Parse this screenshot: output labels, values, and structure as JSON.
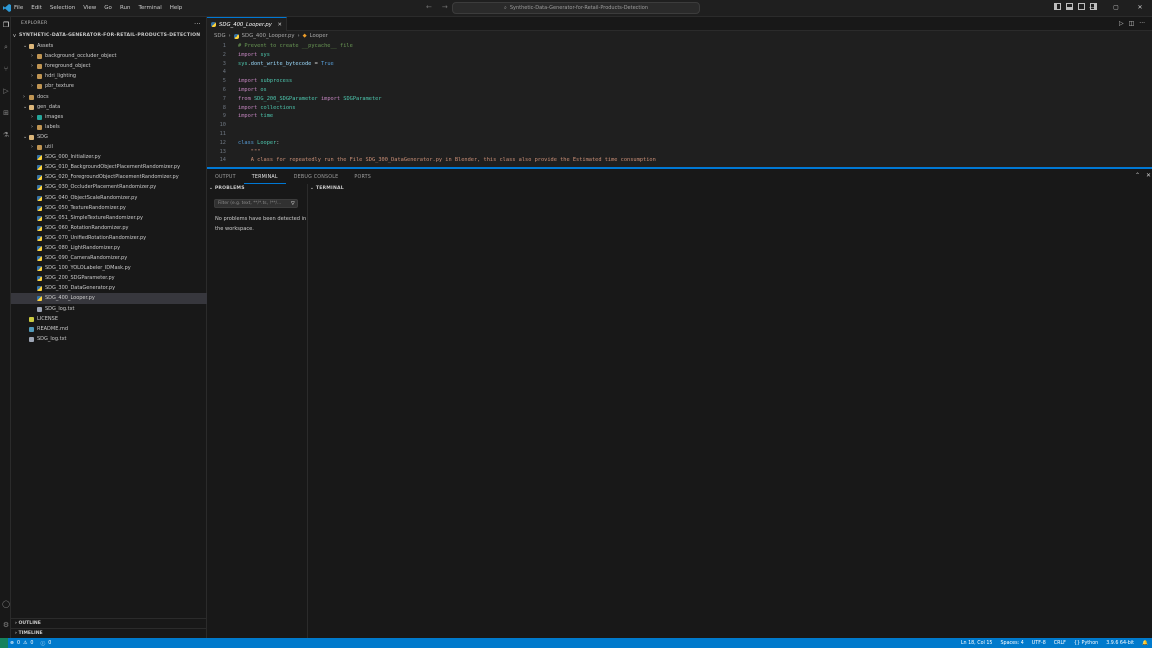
{
  "menubar": {
    "items": [
      "File",
      "Edit",
      "Selection",
      "View",
      "Go",
      "Run",
      "Terminal",
      "Help"
    ]
  },
  "command_center": {
    "text": "Synthetic-Data-Generator-for-Retail-Products-Detection"
  },
  "sidebar": {
    "title": "EXPLORER",
    "root": "SYNTHETIC-DATA-GENERATOR-FOR-RETAIL-PRODUCTS-DETECTION",
    "items": [
      {
        "label": "Assets",
        "type": "folder-open",
        "indent": 1,
        "chev": "v"
      },
      {
        "label": "background_occluder_object",
        "type": "folder",
        "indent": 2,
        "chev": ">"
      },
      {
        "label": "foreground_object",
        "type": "folder",
        "indent": 2,
        "chev": ">"
      },
      {
        "label": "hdri_lighting",
        "type": "folder",
        "indent": 2,
        "chev": ">"
      },
      {
        "label": "pbr_texture",
        "type": "folder",
        "indent": 2,
        "chev": ">"
      },
      {
        "label": "docs",
        "type": "folder",
        "indent": 1,
        "chev": ">"
      },
      {
        "label": "gen_data",
        "type": "folder-open",
        "indent": 1,
        "chev": "v"
      },
      {
        "label": "images",
        "type": "img",
        "indent": 2,
        "chev": ">"
      },
      {
        "label": "labels",
        "type": "folder",
        "indent": 2,
        "chev": ">"
      },
      {
        "label": "SDG",
        "type": "folder-open",
        "indent": 1,
        "chev": "v"
      },
      {
        "label": "util",
        "type": "folder",
        "indent": 2,
        "chev": ">"
      },
      {
        "label": "SDG_000_Initializer.py",
        "type": "py",
        "indent": 2
      },
      {
        "label": "SDG_010_BackgroundObjectPlacementRandomizer.py",
        "type": "py",
        "indent": 2
      },
      {
        "label": "SDG_020_ForegroundObjectPlacementRandomizer.py",
        "type": "py",
        "indent": 2
      },
      {
        "label": "SDG_030_OccluderPlacementRandomizer.py",
        "type": "py",
        "indent": 2
      },
      {
        "label": "SDG_040_ObjectScaleRandomizer.py",
        "type": "py",
        "indent": 2
      },
      {
        "label": "SDG_050_TextureRandomizer.py",
        "type": "py",
        "indent": 2
      },
      {
        "label": "SDG_051_SimpleTextureRandomizer.py",
        "type": "py",
        "indent": 2
      },
      {
        "label": "SDG_060_RotationRandomizer.py",
        "type": "py",
        "indent": 2
      },
      {
        "label": "SDG_070_UnifiedRotationRandomizer.py",
        "type": "py",
        "indent": 2
      },
      {
        "label": "SDG_080_LightRandomizer.py",
        "type": "py",
        "indent": 2
      },
      {
        "label": "SDG_090_CameraRandomizer.py",
        "type": "py",
        "indent": 2
      },
      {
        "label": "SDG_100_YOLOLabeler_IDMask.py",
        "type": "py",
        "indent": 2
      },
      {
        "label": "SDG_200_SDGParameter.py",
        "type": "py",
        "indent": 2
      },
      {
        "label": "SDG_300_DataGenerator.py",
        "type": "py",
        "indent": 2
      },
      {
        "label": "SDG_400_Looper.py",
        "type": "py",
        "indent": 2,
        "selected": true
      },
      {
        "label": "SDG_log.txt",
        "type": "txt",
        "indent": 2
      },
      {
        "label": "LICENSE",
        "type": "lic",
        "indent": 1
      },
      {
        "label": "README.md",
        "type": "md",
        "indent": 1
      },
      {
        "label": "SDG_log.txt",
        "type": "txt",
        "indent": 1
      }
    ],
    "outline": "OUTLINE",
    "timeline": "TIMELINE"
  },
  "editor": {
    "tab": "SDG_400_Looper.py",
    "breadcrumb": [
      "SDG",
      "SDG_400_Looper.py",
      "Looper"
    ],
    "lines": [
      {
        "n": "1",
        "parts": [
          [
            "cm",
            "# Prevent to create __pycache__ file"
          ]
        ]
      },
      {
        "n": "2",
        "parts": [
          [
            "kw",
            "import"
          ],
          [
            "wt",
            " "
          ],
          [
            "fn",
            "sys"
          ]
        ]
      },
      {
        "n": "3",
        "parts": [
          [
            "fn",
            "sys"
          ],
          [
            "wt",
            "."
          ],
          [
            "vr",
            "dont_write_bytecode"
          ],
          [
            "wt",
            " = "
          ],
          [
            "kb",
            "True"
          ]
        ]
      },
      {
        "n": "4",
        "parts": []
      },
      {
        "n": "5",
        "parts": [
          [
            "kw",
            "import"
          ],
          [
            "wt",
            " "
          ],
          [
            "fn",
            "subprocess"
          ]
        ]
      },
      {
        "n": "6",
        "parts": [
          [
            "kw",
            "import"
          ],
          [
            "wt",
            " "
          ],
          [
            "fn",
            "os"
          ]
        ]
      },
      {
        "n": "7",
        "parts": [
          [
            "kw",
            "from"
          ],
          [
            "wt",
            " "
          ],
          [
            "fn",
            "SDG_200_SDGParameter"
          ],
          [
            "wt",
            " "
          ],
          [
            "kw",
            "import"
          ],
          [
            "wt",
            " "
          ],
          [
            "fn",
            "SDGParameter"
          ]
        ]
      },
      {
        "n": "8",
        "parts": [
          [
            "kw",
            "import"
          ],
          [
            "wt",
            " "
          ],
          [
            "fn",
            "collections"
          ]
        ]
      },
      {
        "n": "9",
        "parts": [
          [
            "kw",
            "import"
          ],
          [
            "wt",
            " "
          ],
          [
            "fn",
            "time"
          ]
        ]
      },
      {
        "n": "10",
        "parts": []
      },
      {
        "n": "11",
        "parts": []
      },
      {
        "n": "12",
        "parts": [
          [
            "kb",
            "class"
          ],
          [
            "wt",
            " "
          ],
          [
            "fn",
            "Looper"
          ],
          [
            "wt",
            ":"
          ]
        ]
      },
      {
        "n": "13",
        "parts": [
          [
            "st",
            "    \"\"\""
          ]
        ]
      },
      {
        "n": "14",
        "parts": [
          [
            "st",
            "    A class for repeatedly run the File SDG_300_DataGenerator.py in Blender, this class also provide the Estimated time consumption"
          ]
        ]
      }
    ]
  },
  "panel": {
    "tabs": [
      "OUTPUT",
      "TERMINAL",
      "DEBUG CONSOLE",
      "PORTS"
    ],
    "active_tab": "TERMINAL",
    "problems_header": "PROBLEMS",
    "filter_placeholder": "Filter (e.g. text, **/*.ts, !**/...",
    "no_problems": "No problems have been detected in the workspace.",
    "terminal_header": "TERMINAL"
  },
  "statusbar": {
    "errors": "0",
    "warnings": "0",
    "info": "0",
    "position": "Ln 18, Col 15",
    "spaces": "Spaces: 4",
    "encoding": "UTF-8",
    "eol": "CRLF",
    "language": "Python",
    "interpreter": "3.9.6 64-bit"
  },
  "colors": {
    "accent": "#0078d4",
    "statusbar": "#007acc"
  }
}
